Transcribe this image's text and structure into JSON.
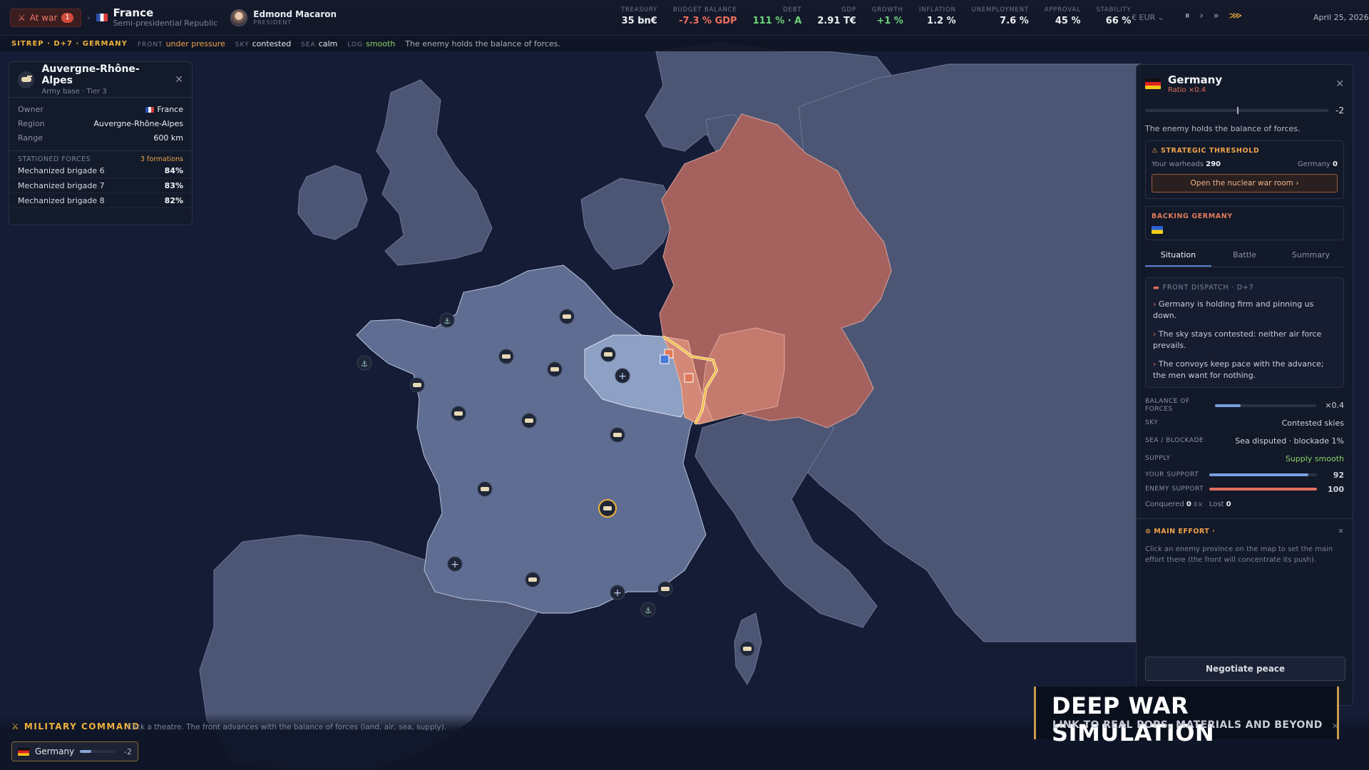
{
  "topbar": {
    "war_label": "At war",
    "war_count": "1",
    "country_name": "France",
    "country_gov": "Semi-presidential Republic",
    "leader_name": "Edmond Macaron",
    "leader_title": "PRESIDENT",
    "stats": [
      {
        "label": "TREASURY",
        "value": "35 bn€",
        "tone": ""
      },
      {
        "label": "BUDGET BALANCE",
        "value": "-7.3 % GDP",
        "tone": "red"
      },
      {
        "label": "DEBT",
        "value": "111 % · A",
        "tone": "green"
      },
      {
        "label": "GDP",
        "value": "2.91 T€",
        "tone": ""
      },
      {
        "label": "GROWTH",
        "value": "+1 %",
        "tone": "green"
      },
      {
        "label": "INFLATION",
        "value": "1.2 %",
        "tone": ""
      },
      {
        "label": "UNEMPLOYMENT",
        "value": "7.6 %",
        "tone": ""
      },
      {
        "label": "APPROVAL",
        "value": "45 %",
        "tone": ""
      },
      {
        "label": "STABILITY",
        "value": "66 %",
        "tone": ""
      }
    ],
    "currency": "€ EUR ⌄",
    "date": "April 25, 2026"
  },
  "sitrep": {
    "tag": "SITREP · D+7 · GERMANY",
    "front_k": "FRONT",
    "front_v": "under pressure",
    "sky_k": "SKY",
    "sky_v": "contested",
    "sea_k": "SEA",
    "sea_v": "calm",
    "log_k": "LOG",
    "log_v": "smooth",
    "message": "The enemy holds the balance of forces."
  },
  "base_panel": {
    "title": "Auvergne-Rhône-Alpes",
    "subtitle": "Army base · Tier 3",
    "owner_k": "Owner",
    "owner_v": "France",
    "region_k": "Region",
    "region_v": "Auvergne-Rhône-Alpes",
    "range_k": "Range",
    "range_v": "600 km",
    "forces_title": "STATIONED FORCES",
    "forces_count": "3 formations",
    "forces": [
      {
        "name": "Mechanized brigade 6",
        "value": "84%"
      },
      {
        "name": "Mechanized brigade 7",
        "value": "83%"
      },
      {
        "name": "Mechanized brigade 8",
        "value": "82%"
      }
    ]
  },
  "right_panel": {
    "enemy": "Germany",
    "ratio": "Ratio ×0.4",
    "balance": "-2",
    "message": "The enemy holds the balance of forces.",
    "threshold_title": "⚠ STRATEGIC THRESHOLD",
    "warheads_k": "Your warheads",
    "warheads_v": "290",
    "enemy_warheads_k": "Germany",
    "enemy_warheads_v": "0",
    "nuke_button": "Open the nuclear war room ›",
    "backing_title": "BACKING GERMANY",
    "tabs": [
      "Situation",
      "Battle",
      "Summary"
    ],
    "dispatch_title": "FRONT DISPATCH · D+7",
    "dispatch": [
      "Germany is holding firm and pinning us down.",
      "The sky stays contested: neither air force prevails.",
      "The convoys keep pace with the advance; the men want for nothing."
    ],
    "balance_k": "BALANCE OF FORCES",
    "balance_v": "×0.4",
    "balance_frac": 0.25,
    "sky_k": "SKY",
    "sky_v": "Contested skies",
    "sea_k": "SEA / BLOCKADE",
    "sea_v": "Sea disputed · blockade 1%",
    "supply_k": "SUPPLY",
    "supply_v": "Supply smooth",
    "your_support_k": "YOUR SUPPORT",
    "your_support_v": "92",
    "enemy_support_k": "ENEMY SUPPORT",
    "enemy_support_v": "100",
    "conquered_k": "Conquered",
    "conquered_v": "0",
    "conquered_u": "0 k",
    "lost_k": "Lost",
    "lost_v": "0",
    "effort_title": "⊙ MAIN EFFORT ·",
    "effort_desc": "Click an enemy province on the map to set the main effort there (the front will concentrate its push).",
    "negotiate": "Negotiate peace"
  },
  "bottom": {
    "title": "⚔ MILITARY COMMAND",
    "hint": "Click a theatre. The front advances with the balance of forces (land, air, sea, supply).",
    "theatre_name": "Germany",
    "theatre_balance": "-2"
  },
  "promo": {
    "headline": "DEEP WAR SIMULATION",
    "subline": "LINK TO REAL POPS, MATERIALS AND BEYOND"
  },
  "colors": {
    "accent": "#f0b23a",
    "enemy": "#c06a62",
    "friendly": "#5f6d92",
    "selected_region": "#8ea0c4"
  }
}
